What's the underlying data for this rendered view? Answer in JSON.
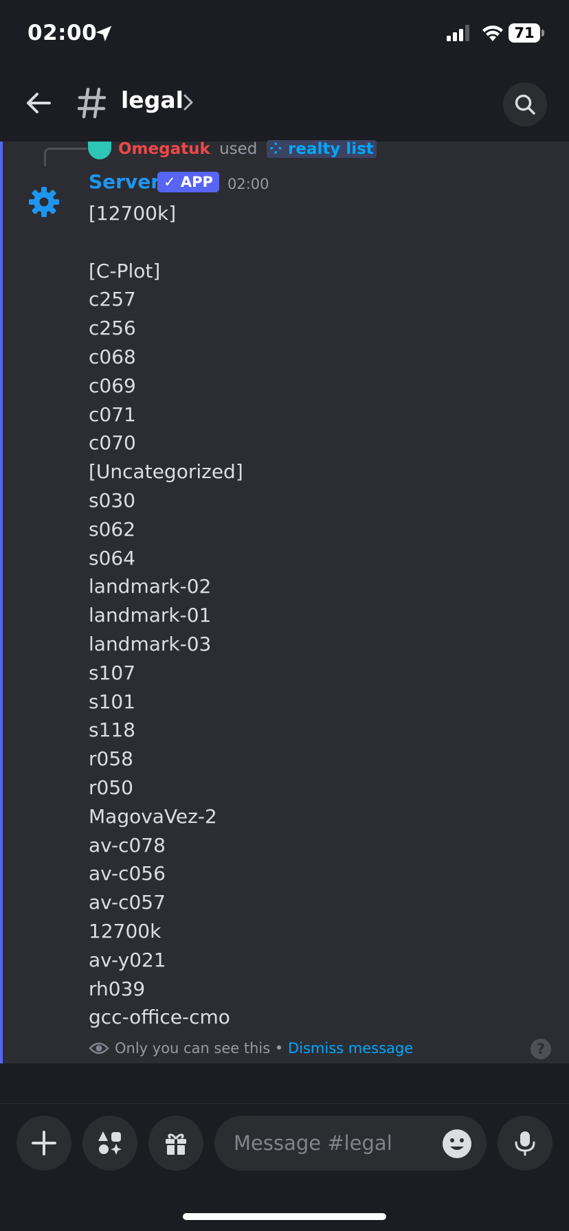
{
  "status_bar": {
    "time": "02:00",
    "battery": "71",
    "icons": [
      "location-arrow-icon",
      "signal-icon",
      "wifi-icon",
      "battery-icon"
    ]
  },
  "header": {
    "channel_name": "legal",
    "icons": [
      "back-arrow-icon",
      "hash-icon",
      "chevron-right-icon",
      "search-icon"
    ]
  },
  "message": {
    "reply": {
      "user": "Omegatuk",
      "verb": "used",
      "command": "realty list"
    },
    "author": "Server",
    "badge": "✓ APP",
    "timestamp": "02:00",
    "lines": [
      "[12700k]",
      "",
      "[C-Plot]",
      "c257",
      "c256",
      "c068",
      "c069",
      "c071",
      "c070",
      "[Uncategorized]",
      "s030",
      "s062",
      "s064",
      "landmark-02",
      "landmark-01",
      "landmark-03",
      "s107",
      "s101",
      "s118",
      "r058",
      "r050",
      "MagovaVez-2",
      "av-c078",
      "av-c056",
      "av-c057",
      "12700k",
      "av-y021",
      "rh039",
      "gcc-office-cmo"
    ],
    "ephemeral_note": "Only you can see this",
    "separator": " • ",
    "dismiss_label": "Dismiss message",
    "help_label": "?"
  },
  "composer": {
    "placeholder": "Message #legal",
    "icons": [
      "plus-icon",
      "apps-icon",
      "gift-icon",
      "emoji-icon",
      "microphone-icon"
    ]
  },
  "colors": {
    "accent": "#5865f2",
    "author": "#1e96f0",
    "reply_user": "#f04747",
    "link": "#00a8fc"
  }
}
